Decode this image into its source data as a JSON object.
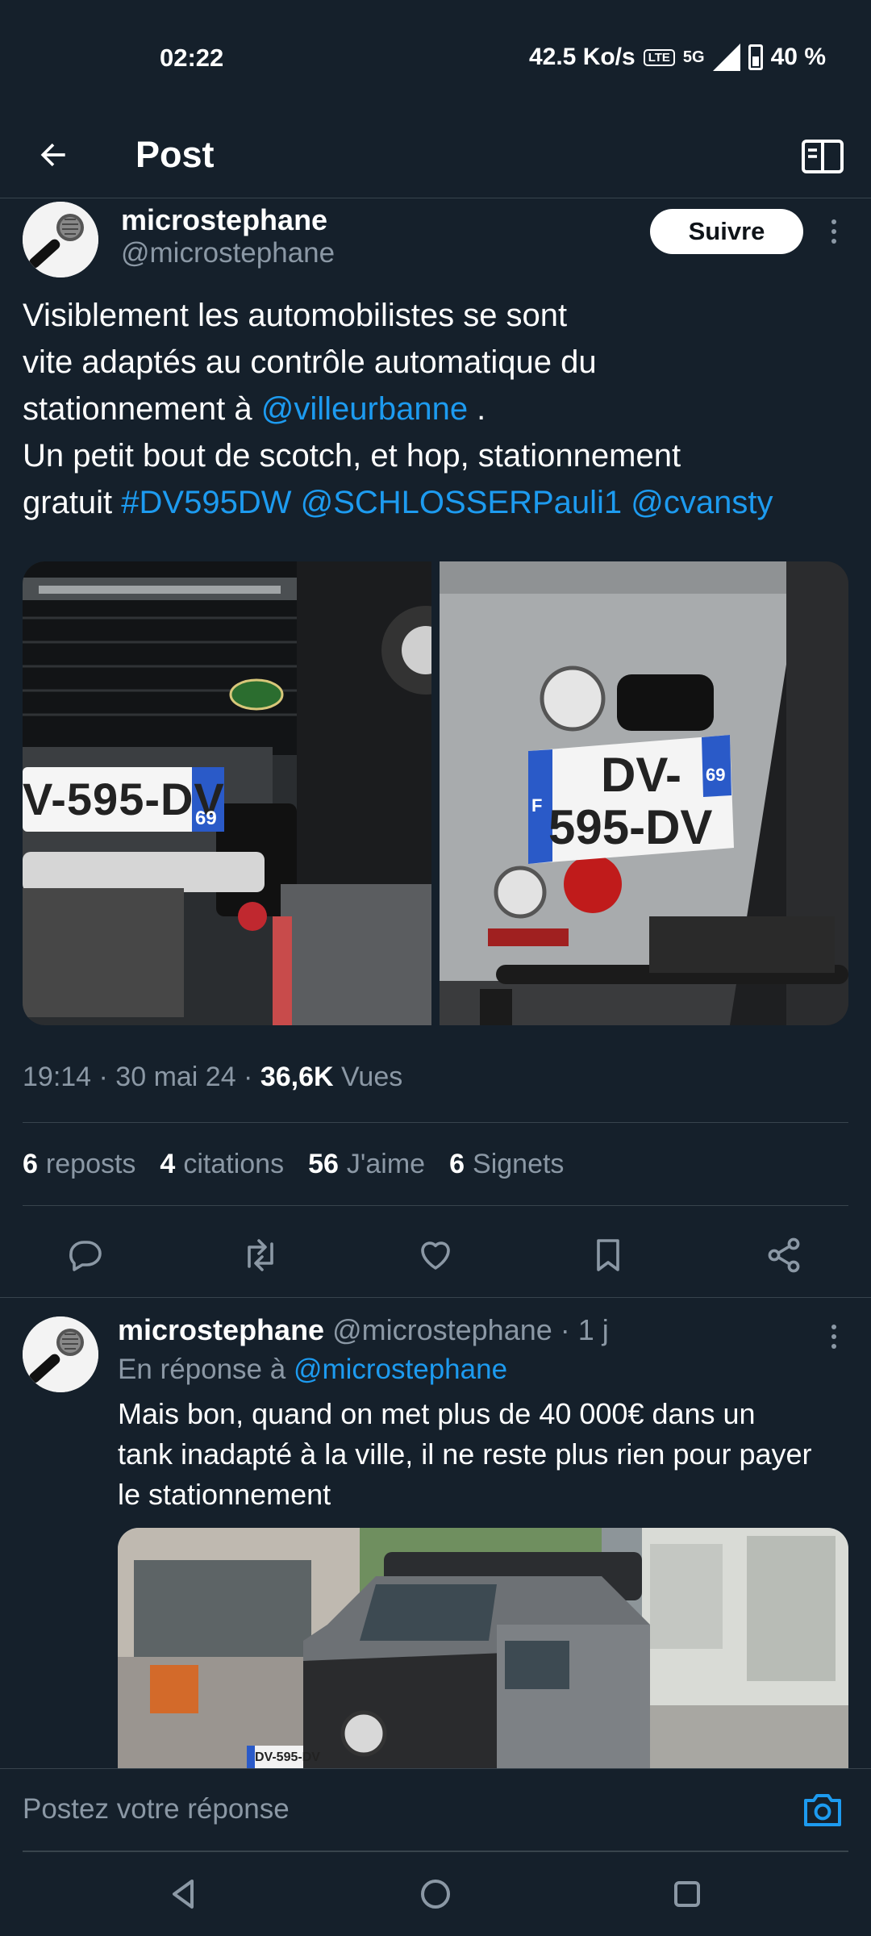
{
  "status": {
    "time": "02:22",
    "speed": "42.5 Ko/s",
    "lte_badge": "LTE",
    "network": "5G",
    "battery": "40 %"
  },
  "header": {
    "title": "Post"
  },
  "post": {
    "author_name": "microstephane",
    "author_handle": "@microstephane",
    "follow_label": "Suivre",
    "text_line1": "Visiblement les automobilistes se sont",
    "text_line2": "vite adaptés au contrôle automatique du",
    "text_line3_pre": "stationnement à ",
    "text_line3_mention": "@villeurbanne",
    "text_line3_post": " .",
    "text_line4": "Un petit bout de scotch, et hop, stationnement",
    "text_line5_pre": "gratuit ",
    "hashtag": "#DV595DW",
    "mention2": "@SCHLOSSERPauli1",
    "mention3": "@cvansty",
    "plate_left": "V-595-DV",
    "plate_left_dept": "69",
    "plate_right_top": "DV-",
    "plate_right_bottom": "595-DV",
    "plate_right_dept": "69",
    "plate_right_country": "F",
    "meta_time": "19:14 · 30 mai 24 · ",
    "views_count": "36,6K",
    "views_label": " Vues",
    "stats": [
      {
        "count": "6",
        "label": "reposts"
      },
      {
        "count": "4",
        "label": "citations"
      },
      {
        "count": "56",
        "label": "J'aime"
      },
      {
        "count": "6",
        "label": "Signets"
      }
    ]
  },
  "reply": {
    "author_name": "microstephane",
    "meta": " @microstephane · 1 j",
    "reply_to_prefix": "En réponse à ",
    "reply_to_handle": "@microstephane",
    "text_line1": "Mais bon, quand on met plus de 40 000€ dans un",
    "text_line2": "tank inadapté à la ville, il ne reste plus rien pour payer",
    "text_line3": "le stationnement",
    "plate": "DV-595-DV"
  },
  "compose": {
    "placeholder": "Postez votre réponse"
  },
  "colors": {
    "background": "#15202b",
    "accent": "#1d9bf0",
    "muted": "#8b98a5",
    "border": "#38444d"
  }
}
